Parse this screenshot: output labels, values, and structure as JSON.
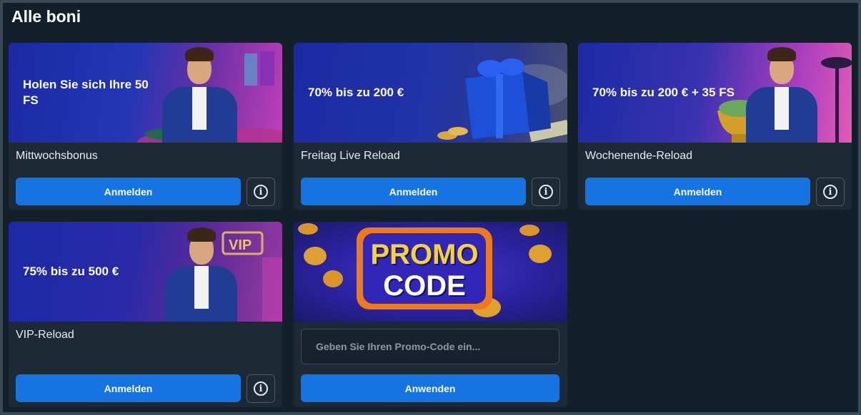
{
  "page": {
    "title": "Alle boni"
  },
  "bonuses": [
    {
      "banner_text": "Holen Sie sich Ihre 50 FS",
      "title": "Mittwochsbonus",
      "button_label": "Anmelden",
      "info_icon": "info-icon"
    },
    {
      "banner_text": "70% bis zu 200 €",
      "title": "Freitag Live Reload",
      "button_label": "Anmelden",
      "info_icon": "info-icon"
    },
    {
      "banner_text": "70% bis zu 200 € + 35 FS",
      "title": "Wochenende-Reload",
      "button_label": "Anmelden",
      "info_icon": "info-icon"
    },
    {
      "banner_text": "75% bis zu 500 €",
      "title": "VIP-Reload",
      "button_label": "Anmelden",
      "info_icon": "info-icon"
    }
  ],
  "promo": {
    "banner_line1": "PROMO",
    "banner_line2": "CODE",
    "input_placeholder": "Geben Sie Ihren Promo-Code ein...",
    "input_value": "",
    "button_label": "Anwenden"
  },
  "colors": {
    "page_bg": "#142029",
    "card_bg": "#1d2a36",
    "button_blue": "#1673e2",
    "banner_blue": "#1c2aa0",
    "neon_pink": "#d23fc8"
  }
}
